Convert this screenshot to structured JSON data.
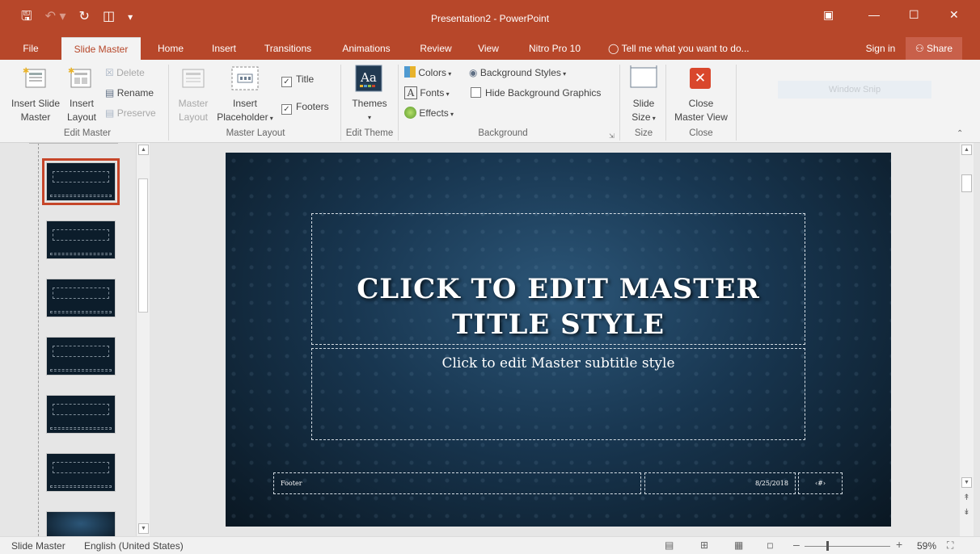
{
  "window": {
    "title": "Presentation2 - PowerPoint",
    "qat": {
      "save_icon": "save-icon",
      "undo_icon": "undo-icon",
      "redo_icon": "redo-icon",
      "start_icon": "start-from-beginning-icon",
      "customize_icon": "customize-qat-icon"
    },
    "controls": {
      "ribbon_display": "ribbon-display-icon",
      "minimize": "minimize-icon",
      "maximize": "maximize-icon",
      "close": "close-icon"
    }
  },
  "tabs": {
    "file": "File",
    "slide_master": "Slide Master",
    "home": "Home",
    "insert": "Insert",
    "transitions": "Transitions",
    "animations": "Animations",
    "review": "Review",
    "view": "View",
    "nitro": "Nitro Pro 10",
    "tell_me": "Tell me what you want to do...",
    "sign_in": "Sign in",
    "share": "Share"
  },
  "ribbon": {
    "edit_master": {
      "label": "Edit Master",
      "insert_slide_master": [
        "Insert Slide",
        "Master"
      ],
      "insert_layout": [
        "Insert",
        "Layout"
      ],
      "delete": "Delete",
      "rename": "Rename",
      "preserve": "Preserve"
    },
    "master_layout": {
      "label": "Master Layout",
      "master_layout_btn": [
        "Master",
        "Layout"
      ],
      "insert_placeholder": [
        "Insert",
        "Placeholder"
      ],
      "title": "Title",
      "footers": "Footers",
      "title_checked": true,
      "footers_checked": true
    },
    "edit_theme": {
      "label": "Edit Theme",
      "themes": "Themes",
      "themes_icon_text": "Aa"
    },
    "background": {
      "label": "Background",
      "colors": "Colors",
      "fonts": "Fonts",
      "effects": "Effects",
      "background_styles": "Background Styles",
      "hide_background_graphics": "Hide Background Graphics",
      "hide_checked": false
    },
    "size": {
      "label": "Size",
      "slide_size": [
        "Slide",
        "Size"
      ]
    },
    "close": {
      "label": "Close",
      "close_master_view": [
        "Close",
        "Master View"
      ]
    },
    "window_snip": "Window Snip"
  },
  "slide": {
    "title_line1": "CLICK TO EDIT MASTER",
    "title_line2": "TITLE STYLE",
    "subtitle": "Click to edit Master subtitle style",
    "footer": "Footer",
    "date": "8/25/2018",
    "page_number": "‹#›"
  },
  "thumbnails": {
    "count": 7,
    "selected_index": 0
  },
  "status": {
    "view_name": "Slide Master",
    "language": "English (United States)",
    "zoom": "59%",
    "zoom_percent": 59
  },
  "colors": {
    "accent": "#b7472a",
    "ribbon_bg": "#f3f3f3",
    "slide_bg": "#183650"
  }
}
